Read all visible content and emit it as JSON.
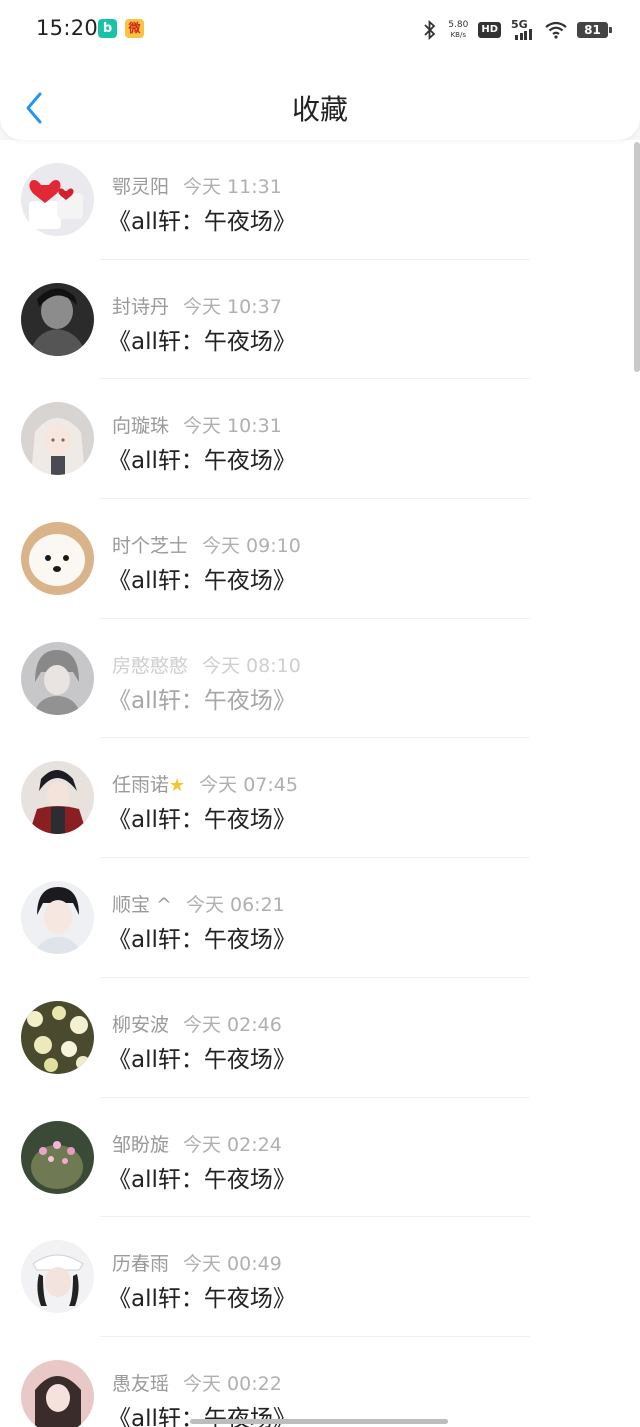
{
  "status_bar": {
    "time": "15:20",
    "app_icons": [
      "b",
      "微"
    ],
    "net_speed_value": "5.80",
    "net_speed_unit": "KB/s",
    "hd_label": "HD",
    "network_label": "5G",
    "battery_level": "81"
  },
  "nav": {
    "title": "收藏",
    "back_icon": "chevron-left-icon",
    "accent_color": "#2196f3"
  },
  "items": [
    {
      "user": "鄂灵阳",
      "time": "今天 11:31",
      "message": "《all轩：午夜场》"
    },
    {
      "user": "封诗丹",
      "time": "今天 10:37",
      "message": "《all轩：午夜场》"
    },
    {
      "user": "向璇珠",
      "time": "今天 10:31",
      "message": "《all轩：午夜场》"
    },
    {
      "user": "时个芝士",
      "time": "今天 09:10",
      "message": "《all轩：午夜场》"
    },
    {
      "user": "房憨憨憨",
      "time": "今天 08:10",
      "message": "《all轩：午夜场》"
    },
    {
      "user": "任雨诺",
      "time": "今天 07:45",
      "message": "《all轩：午夜场》"
    },
    {
      "user": "顺宝 ^",
      "time": "今天 06:21",
      "message": "《all轩：午夜场》"
    },
    {
      "user": "柳安波",
      "time": "今天 02:46",
      "message": "《all轩：午夜场》"
    },
    {
      "user": "邹盼旋",
      "time": "今天 02:24",
      "message": "《all轩：午夜场》"
    },
    {
      "user": "历春雨",
      "time": "今天 00:49",
      "message": "《all轩：午夜场》"
    },
    {
      "user": "愚友瑶",
      "time": "今天 00:22",
      "message": "《all轩：午夜场》"
    }
  ]
}
